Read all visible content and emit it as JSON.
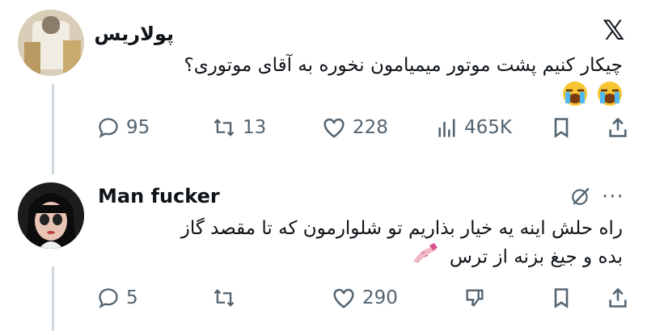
{
  "brand": {
    "logo": "𝕏"
  },
  "posts": [
    {
      "author": "پولاریس",
      "avatar": "blurred-photo",
      "text": "چیکار کنیم پشت موتور میمیامون نخوره به آقای موتوری؟",
      "emojis": [
        "loudly-crying-face",
        "loudly-crying-face"
      ],
      "stats": {
        "replies": "95",
        "reposts": "13",
        "likes": "228",
        "views": "465K"
      }
    },
    {
      "author": "Man fucker",
      "avatar": "doll-photo",
      "text_line1": "راه حلش اینه یه خیار بذاریم تو شلوارمون که تا مقصد گاز",
      "text_line2": "بده و جیغ بزنه از ترس",
      "emoji": "nail-polish",
      "stats": {
        "replies": "5",
        "reposts": "",
        "likes": "290"
      }
    }
  ],
  "colors": {
    "text": "#0f1419",
    "muted": "#536471",
    "thread": "#cfd9de"
  },
  "menu": {
    "more": "···"
  }
}
